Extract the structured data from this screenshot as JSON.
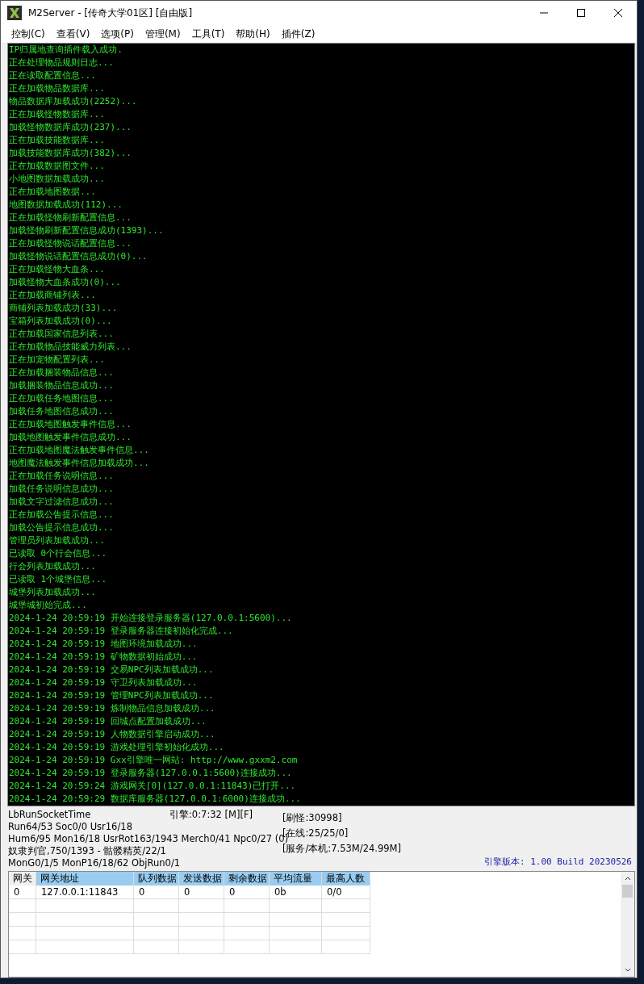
{
  "window": {
    "title": "M2Server - [传奇大学01区] [自由版]"
  },
  "menu": [
    "控制(C)",
    "查看(V)",
    "选项(P)",
    "管理(M)",
    "工具(T)",
    "帮助(H)",
    "插件(Z)"
  ],
  "log": [
    "IP归属地查询插件载入成功.",
    "正在处理物品规则日志...",
    "正在读取配置信息...",
    "正在加载物品数据库...",
    "物品数据库加载成功(2252)...",
    "正在加载怪物数据库...",
    "加载怪物数据库成功(237)...",
    "正在加载技能数据库...",
    "加载技能数据库成功(382)...",
    "正在加载数据图文件...",
    "小地图数据加载成功...",
    "正在加载地图数据...",
    "地图数据加载成功(112)...",
    "正在加载怪物刷新配置信息...",
    "加载怪物刷新配置信息成功(1393)...",
    "正在加载怪物说话配置信息...",
    "加载怪物说话配置信息成功(0)...",
    "正在加载怪物大血条...",
    "加载怪物大血条成功(0)...",
    "正在加载商铺列表...",
    "商铺列表加载成功(33)...",
    "宝箱列表加载成功(0)...",
    "正在加载国家信息列表...",
    "正在加载物品技能威力列表...",
    "正在加宠物配置列表...",
    "正在加载捆装物品信息...",
    "加载捆装物品信息成功...",
    "正在加载任务地图信息...",
    "加载任务地图信息成功...",
    "正在加载地图触发事件信息...",
    "加载地图触发事件信息成功...",
    "正在加载地图魔法触发事件信息...",
    "地图魔法触发事件信息加载成功...",
    "正在加载任务说明信息...",
    "加载任务说明信息成功...",
    "加载文字过滤信息成功...",
    "正在加载公告提示信息...",
    "加载公告提示信息成功...",
    "管理员列表加载成功...",
    "已读取 0个行会信息...",
    "行会列表加载成功...",
    "已读取 1个城堡信息...",
    "城堡列表加载成功...",
    "城堡城初始完成...",
    "2024-1-24 20:59:19 开始连接登录服务器(127.0.0.1:5600)...",
    "2024-1-24 20:59:19 登录服务器连接初始化完成...",
    "2024-1-24 20:59:19 地图环境加载成功...",
    "2024-1-24 20:59:19 矿物数据初始成功...",
    "2024-1-24 20:59:19 交易NPC列表加载成功...",
    "2024-1-24 20:59:19 守卫列表加载成功...",
    "2024-1-24 20:59:19 管理NPC列表加载成功...",
    "2024-1-24 20:59:19 炼制物品信息加载成功...",
    "2024-1-24 20:59:19 回城点配置加载成功...",
    "2024-1-24 20:59:19 人物数据引擎启动成功...",
    "2024-1-24 20:59:19 游戏处理引擎初始化成功...",
    "2024-1-24 20:59:19 Gxx引擎唯一网站: http://www.gxxm2.com",
    "2024-1-24 20:59:19 登录服务器(127.0.0.1:5600)连接成功...",
    "2024-1-24 20:59:24 游戏网关[0](127.0.0.1:11843)已打开...",
    "2024-1-24 20:59:29 数据库服务器(127.0.0.1:6000)连接成功..."
  ],
  "status": {
    "left": [
      "LbRunSocketTime",
      "Run64/53 Soc0/0 Usr16/18",
      "Hum6/95 Mon16/18 UsrRot163/1943 Merch0/41 Npc0/27 (0)",
      "奴隶判官,750/1393 - 骷髅精英/22/1",
      "MonG0/1/5 MonP16/18/62 ObjRun0/1"
    ],
    "engine_time": "引擎:0:7:32 [M][F]",
    "right": [
      "[刷怪:30998]",
      "[在线:25/25/0]",
      "[服务/本机:7.53M/24.99M]"
    ],
    "version": "引擎版本: 1.00 Build 20230526"
  },
  "table": {
    "columns": [
      {
        "label": "网关",
        "highlighted": false
      },
      {
        "label": "网关地址",
        "highlighted": true
      },
      {
        "label": "队列数据",
        "highlighted": true
      },
      {
        "label": "发送数据",
        "highlighted": true
      },
      {
        "label": "剩余数据",
        "highlighted": true
      },
      {
        "label": "平均流量",
        "highlighted": true
      },
      {
        "label": "最高人数",
        "highlighted": true
      }
    ],
    "rows": [
      [
        "0",
        "127.0.0.1:11843",
        "0",
        "0",
        "0",
        "0b",
        "0/0"
      ]
    ]
  }
}
